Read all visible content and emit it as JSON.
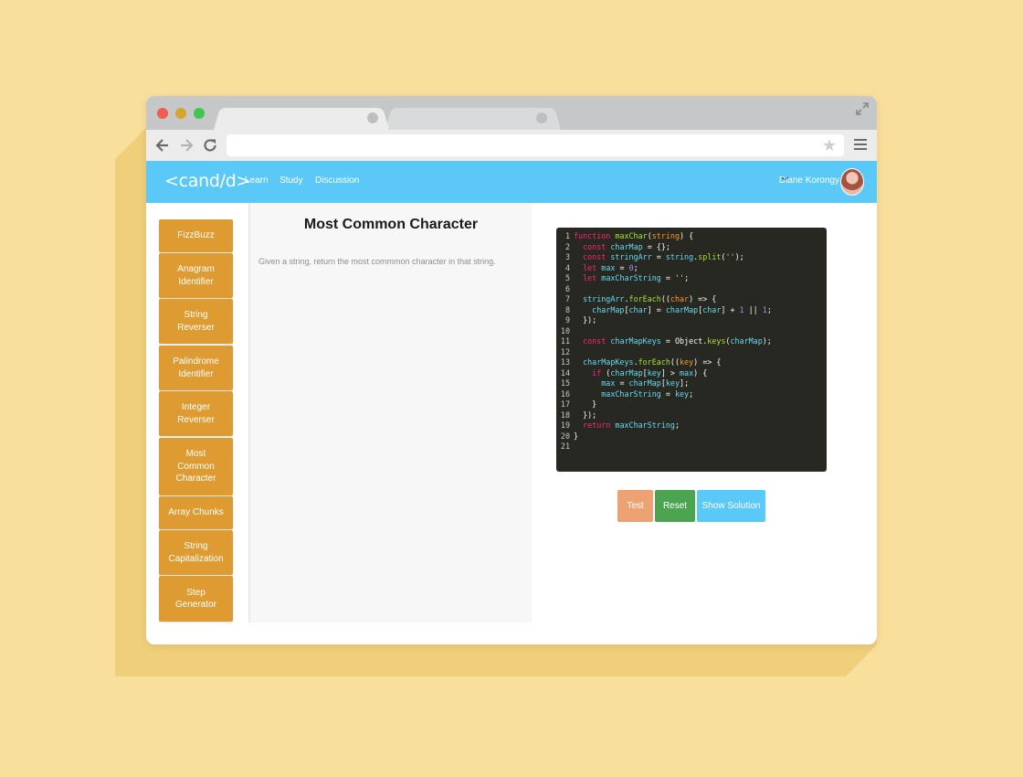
{
  "browser": {
    "url": ""
  },
  "app": {
    "logo": "<cand/d>",
    "nav": [
      "Learn",
      "Study",
      "Discussion"
    ],
    "user_name": "Diane Korongy"
  },
  "sidebar": {
    "items": [
      "FizzBuzz",
      "Anagram\nIdentifier",
      "String\nReverser",
      "Palindrome\nIdentifier",
      "Integer\nReverser",
      "Most\nCommon\nCharacter",
      "Array Chunks",
      "String\nCapitalization",
      "Step\nGenerator"
    ]
  },
  "problem": {
    "title": "Most Common Character",
    "description": "Given a string, return the most commmon character in that string."
  },
  "editor": {
    "lines": [
      "function maxChar(string) {",
      "  const charMap = {};",
      "  const stringArr = string.split('');",
      "  let max = 0;",
      "  let maxCharString = '';",
      "",
      "  stringArr.forEach((char) => {",
      "    charMap[char] = charMap[char] + 1 || 1;",
      "  });",
      "",
      "  const charMapKeys = Object.keys(charMap);",
      "",
      "  charMapKeys.forEach((key) => {",
      "    if (charMap[key] > max) {",
      "      max = charMap[key];",
      "      maxCharString = key;",
      "    }",
      "  });",
      "  return maxCharString;",
      "}",
      ""
    ]
  },
  "actions": {
    "test": "Test",
    "reset": "Reset",
    "show_solution": "Show Solution"
  },
  "colors": {
    "background": "#f8df9c",
    "app_bar": "#5bc9f8",
    "sidebar_item": "#dd9b32",
    "test_button": "#eca273",
    "reset_button": "#4ca451",
    "editor_bg": "#272822"
  }
}
